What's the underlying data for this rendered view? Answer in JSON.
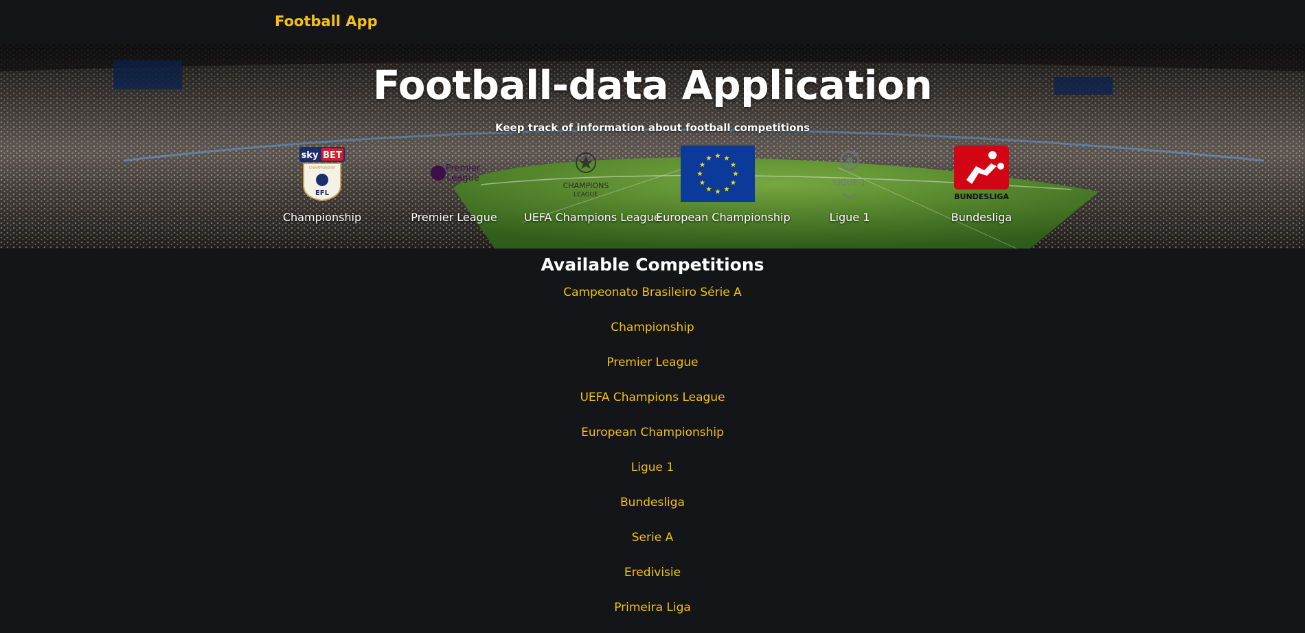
{
  "navbar": {
    "brand": "Football App"
  },
  "hero": {
    "title": "Football-data Application",
    "subtitle": "Keep track of information about football competitions",
    "featured": [
      {
        "label": "Championship",
        "icon": "efl-championship-logo"
      },
      {
        "label": "Premier League",
        "icon": "premier-league-logo"
      },
      {
        "label": "UEFA Champions League",
        "icon": "champions-league-logo"
      },
      {
        "label": "European Championship",
        "icon": "eu-flag-logo"
      },
      {
        "label": "Ligue 1",
        "icon": "ligue-1-logo"
      },
      {
        "label": "Bundesliga",
        "icon": "bundesliga-logo"
      }
    ],
    "logo_text": {
      "skybet_sky": "sky",
      "skybet_bet": "BET",
      "skybet_championship": "CHAMPIONSHIP",
      "efl": "EFL",
      "pl_line1": "Premier",
      "pl_line2": "League",
      "ucl_line1": "CHAMPIONS",
      "ucl_line2": "LEAGUE",
      "ligue1": "LIGUE 1",
      "bundesliga": "BUNDESLIGA"
    }
  },
  "competitions": {
    "title": "Available Competitions",
    "items": [
      "Campeonato Brasileiro Série A",
      "Championship",
      "Premier League",
      "UEFA Champions League",
      "European Championship",
      "Ligue 1",
      "Bundesliga",
      "Serie A",
      "Eredivisie",
      "Primeira Liga"
    ]
  },
  "colors": {
    "background": "#131519",
    "accent": "#f4c20d",
    "text": "#ffffff"
  }
}
